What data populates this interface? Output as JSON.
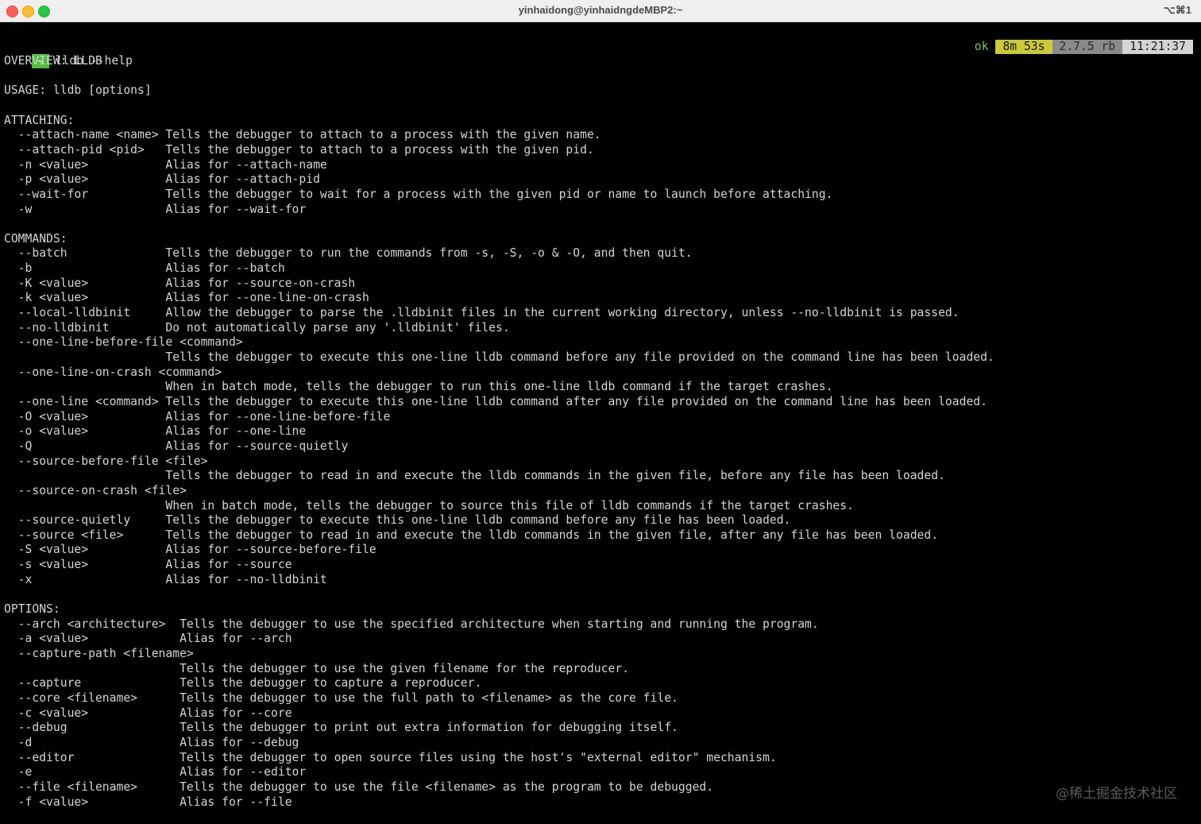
{
  "window": {
    "title": "yinhaidong@yinhaidngdeMBP2:~",
    "shortcut": "⌥⌘1"
  },
  "prompt": {
    "tilde": "~",
    "command": "lldb --help"
  },
  "right_prompt": {
    "status": "ok",
    "duration": "8m 53s",
    "ruby": "2.7.5 rb",
    "clock": "11:21:37"
  },
  "output_lines": [
    "OVERVIEW: LLDB",
    "",
    "USAGE: lldb [options]",
    "",
    "ATTACHING:",
    "  --attach-name <name> Tells the debugger to attach to a process with the given name.",
    "  --attach-pid <pid>   Tells the debugger to attach to a process with the given pid.",
    "  -n <value>           Alias for --attach-name",
    "  -p <value>           Alias for --attach-pid",
    "  --wait-for           Tells the debugger to wait for a process with the given pid or name to launch before attaching.",
    "  -w                   Alias for --wait-for",
    "",
    "COMMANDS:",
    "  --batch              Tells the debugger to run the commands from -s, -S, -o & -O, and then quit.",
    "  -b                   Alias for --batch",
    "  -K <value>           Alias for --source-on-crash",
    "  -k <value>           Alias for --one-line-on-crash",
    "  --local-lldbinit     Allow the debugger to parse the .lldbinit files in the current working directory, unless --no-lldbinit is passed.",
    "  --no-lldbinit        Do not automatically parse any '.lldbinit' files.",
    "  --one-line-before-file <command>",
    "                       Tells the debugger to execute this one-line lldb command before any file provided on the command line has been loaded.",
    "  --one-line-on-crash <command>",
    "                       When in batch mode, tells the debugger to run this one-line lldb command if the target crashes.",
    "  --one-line <command> Tells the debugger to execute this one-line lldb command after any file provided on the command line has been loaded.",
    "  -O <value>           Alias for --one-line-before-file",
    "  -o <value>           Alias for --one-line",
    "  -Q                   Alias for --source-quietly",
    "  --source-before-file <file>",
    "                       Tells the debugger to read in and execute the lldb commands in the given file, before any file has been loaded.",
    "  --source-on-crash <file>",
    "                       When in batch mode, tells the debugger to source this file of lldb commands if the target crashes.",
    "  --source-quietly     Tells the debugger to execute this one-line lldb command before any file has been loaded.",
    "  --source <file>      Tells the debugger to read in and execute the lldb commands in the given file, after any file has been loaded.",
    "  -S <value>           Alias for --source-before-file",
    "  -s <value>           Alias for --source",
    "  -x                   Alias for --no-lldbinit",
    "",
    "OPTIONS:",
    "  --arch <architecture>  Tells the debugger to use the specified architecture when starting and running the program.",
    "  -a <value>             Alias for --arch",
    "  --capture-path <filename>",
    "                         Tells the debugger to use the given filename for the reproducer.",
    "  --capture              Tells the debugger to capture a reproducer.",
    "  --core <filename>      Tells the debugger to use the full path to <filename> as the core file.",
    "  -c <value>             Alias for --core",
    "  --debug                Tells the debugger to print out extra information for debugging itself.",
    "  -d                     Alias for --debug",
    "  --editor               Tells the debugger to open source files using the host's \"external editor\" mechanism.",
    "  -e                     Alias for --editor",
    "  --file <filename>      Tells the debugger to use the file <filename> as the program to be debugged.",
    "  -f <value>             Alias for --file"
  ],
  "watermark": "@稀土掘金技术社区",
  "colors": {
    "background": "#000000",
    "text": "#d4d4d4",
    "tilde_bg": "#4cbf3d",
    "status_ok": "#7fc24b",
    "duration_bg": "#c9c93a",
    "ruby_bg": "#8a8a8a",
    "clock_bg": "#d4d4d4"
  }
}
